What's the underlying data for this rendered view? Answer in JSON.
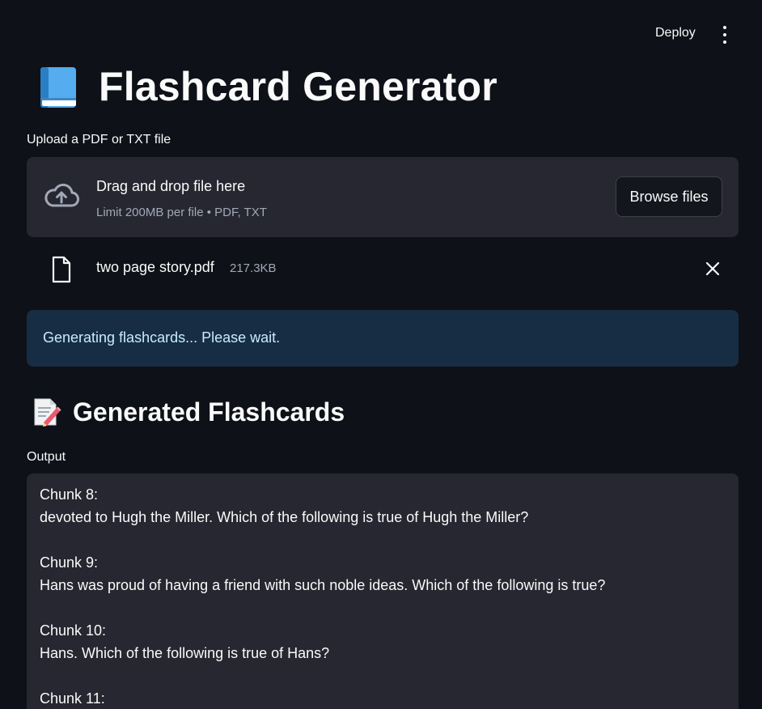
{
  "header": {
    "deploy_label": "Deploy",
    "menu_icon": "vertical-ellipsis"
  },
  "title": {
    "icon": "blue-book-emoji",
    "text": "Flashcard Generator"
  },
  "uploader": {
    "label": "Upload a PDF or TXT file",
    "dropzone_main": "Drag and drop file here",
    "dropzone_sub": "Limit 200MB per file • PDF, TXT",
    "browse_label": "Browse files",
    "file": {
      "name": "two page story.pdf",
      "size": "217.3KB"
    }
  },
  "alert": {
    "text": "Generating flashcards... Please wait."
  },
  "section": {
    "icon": "memo-emoji",
    "title": "Generated Flashcards"
  },
  "output": {
    "label": "Output",
    "chunks": [
      {
        "heading": "Chunk 8:",
        "text": "devoted to Hugh the Miller. Which of the following is true of Hugh the Miller?"
      },
      {
        "heading": "Chunk 9:",
        "text": "Hans was proud of having a friend with such noble ideas. Which of the following is true?"
      },
      {
        "heading": "Chunk 10:",
        "text": "Hans. Which of the following is true of Hans?"
      },
      {
        "heading": "Chunk 11:",
        "text": ""
      }
    ]
  },
  "colors": {
    "background": "#0e1117",
    "surface": "#262730",
    "alert_bg": "#172d43",
    "alert_text": "#c7ebff"
  }
}
